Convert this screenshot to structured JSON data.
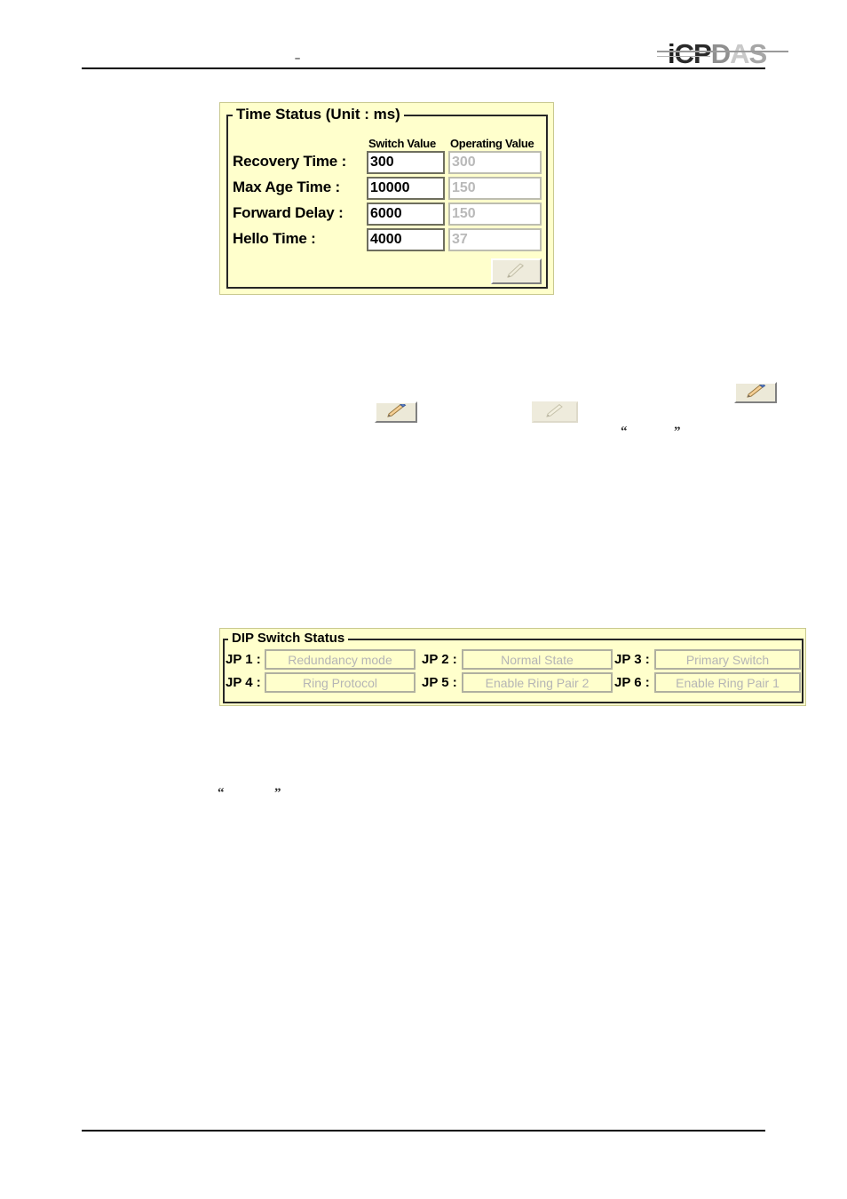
{
  "page": {
    "header_mark": "–",
    "logo": {
      "part1": "i",
      "part2": "CP",
      "part3": "D",
      "part4": "A",
      "part5": "S",
      "full": "ICP DAS"
    }
  },
  "time_status": {
    "title": "Time Status (Unit : ms)",
    "columns": [
      "Switch Value",
      "Operating Value"
    ],
    "rows": [
      {
        "label": "Recovery Time :",
        "switch_value": "300",
        "operating_value": "300"
      },
      {
        "label": "Max Age Time :",
        "switch_value": "10000",
        "operating_value": "150"
      },
      {
        "label": "Forward Delay :",
        "switch_value": "6000",
        "operating_value": "150"
      },
      {
        "label": "Hello Time :",
        "switch_value": "4000",
        "operating_value": "37"
      }
    ],
    "apply_button": {
      "icon": "pencil-icon",
      "enabled": false
    }
  },
  "dip_status": {
    "title": "DIP Switch Status",
    "entries": [
      {
        "label": "JP 1 :",
        "value": "Redundancy mode"
      },
      {
        "label": "JP 2 :",
        "value": "Normal State"
      },
      {
        "label": "JP 3 :",
        "value": "Primary Switch"
      },
      {
        "label": "JP 4 :",
        "value": "Ring Protocol"
      },
      {
        "label": "JP 5 :",
        "value": "Enable Ring Pair 2"
      },
      {
        "label": "JP 6 :",
        "value": "Enable Ring Pair 1"
      }
    ]
  },
  "inline_buttons": [
    {
      "name": "pencil-button-left",
      "icon": "pencil-icon",
      "enabled": true
    },
    {
      "name": "pencil-button-mid",
      "icon": "pencil-icon",
      "enabled": false
    },
    {
      "name": "pencil-button-right",
      "icon": "pencil-icon",
      "enabled": true
    }
  ],
  "quotes": {
    "open": "“",
    "close": "”"
  },
  "colors": {
    "panel_background": "#FFFFCC",
    "panel_border": "#262626",
    "field_background": "#FFFFFF",
    "field_border": "#6E6E5E",
    "readonly_text": "#B9B9B9",
    "button_face": "#ECE9D8",
    "rule": "#000000"
  }
}
